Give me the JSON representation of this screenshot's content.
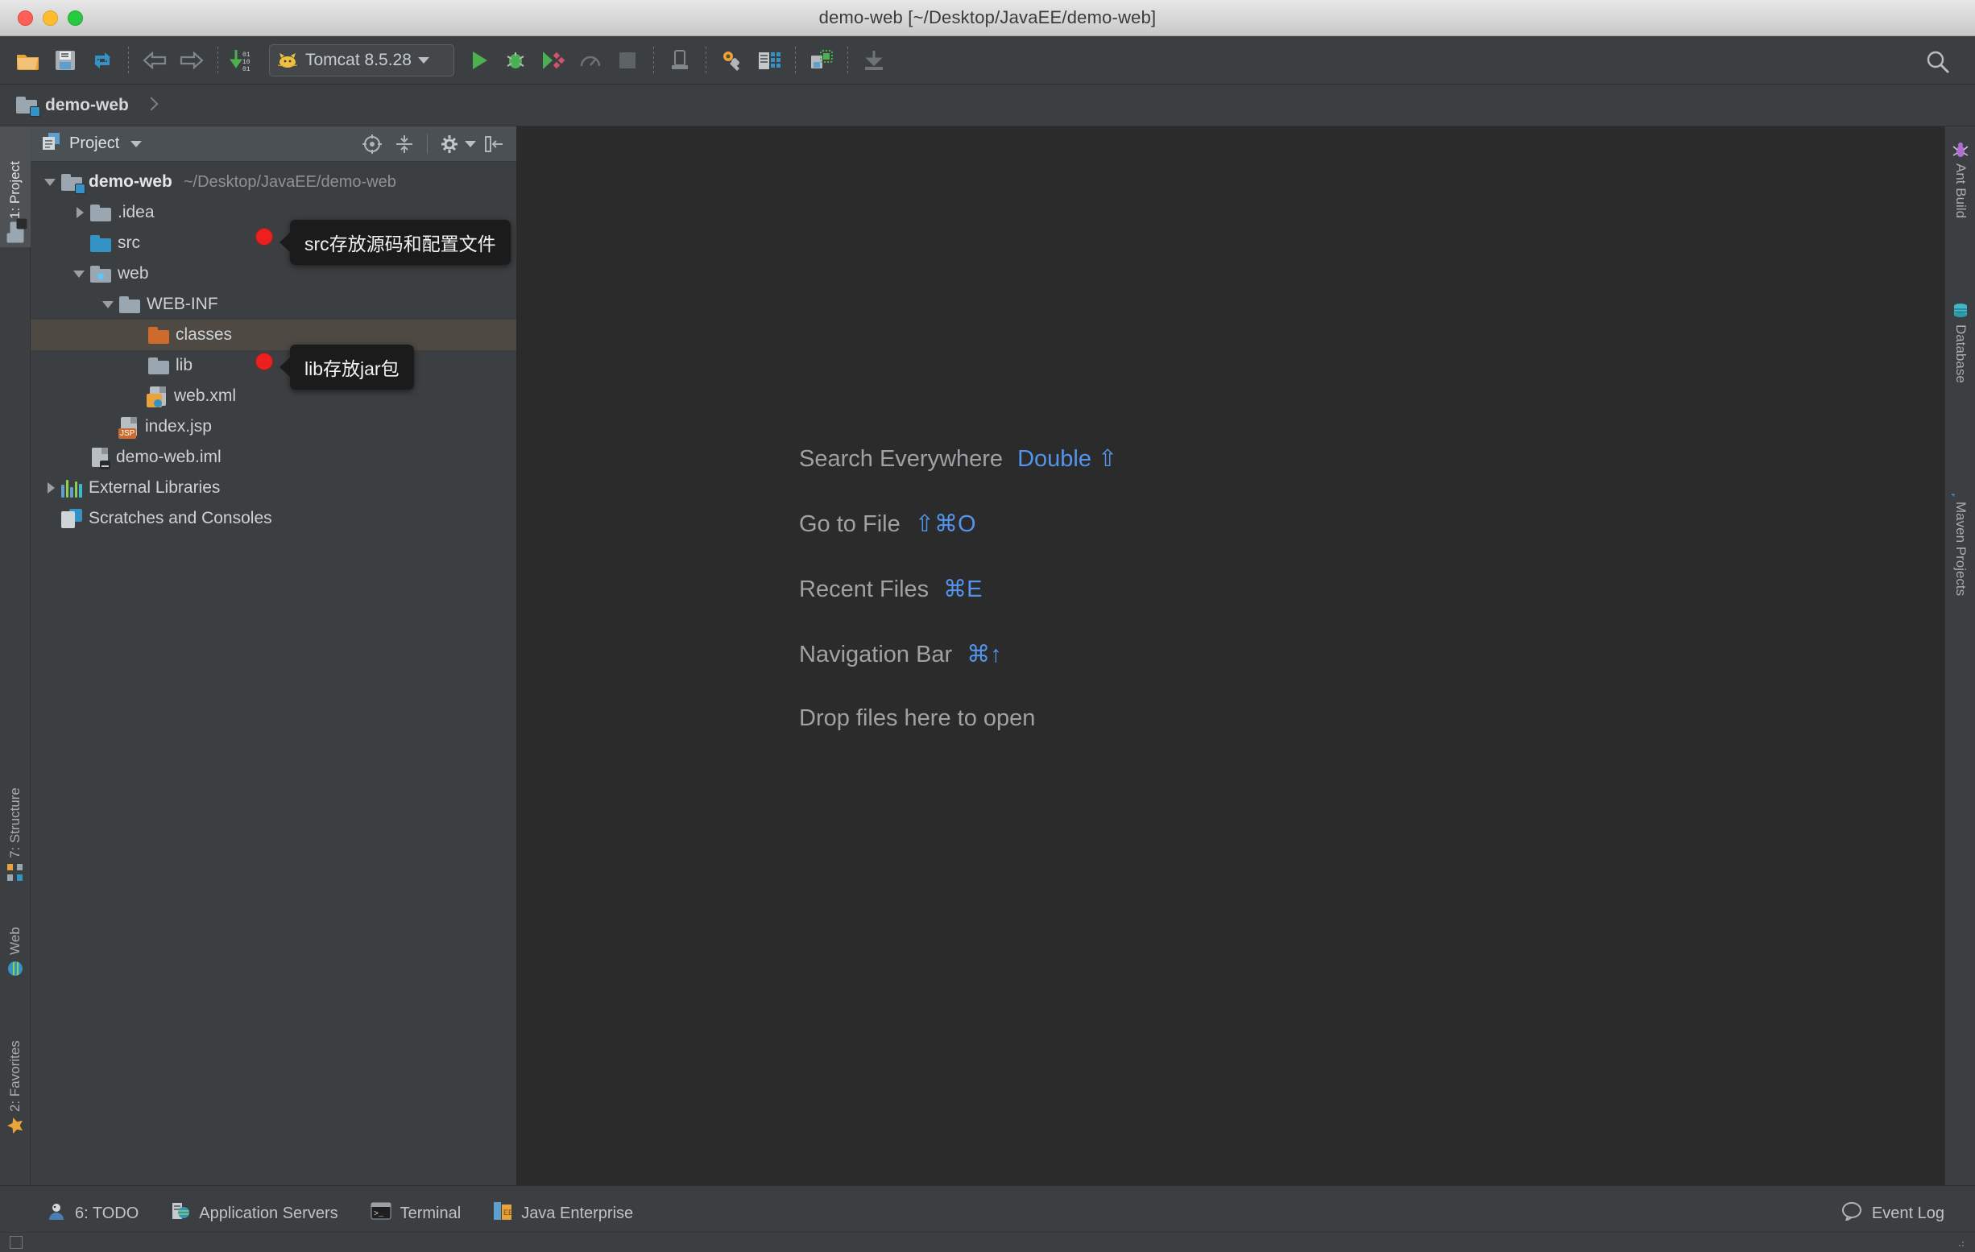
{
  "window": {
    "title": "demo-web [~/Desktop/JavaEE/demo-web]",
    "traffic_lights": [
      "close-red",
      "minimize-yellow",
      "zoom-green"
    ]
  },
  "toolbar": {
    "open_label": "Open",
    "save_label": "Save All",
    "sync_label": "Synchronize",
    "back_label": "Back",
    "forward_label": "Forward",
    "update_label": "Update Project",
    "run_config": {
      "name": "Tomcat 8.5.28",
      "icon": "tomcat-cat-icon"
    },
    "run_label": "Run",
    "debug_label": "Debug",
    "coverage_label": "Run with Coverage",
    "profile_label": "Profile",
    "stop_label": "Stop",
    "deploy_label": "Deploy",
    "settings_label": "Project Structure",
    "structure_label": "Settings",
    "sdk_label": "SDK",
    "download_label": "Download",
    "search_label": "Search"
  },
  "navbar": {
    "crumb": "demo-web"
  },
  "left_tool_strip": {
    "top": [
      {
        "label": "1: Project",
        "icon": "project-folder-icon",
        "selected": true
      }
    ],
    "bottom": [
      {
        "label": "7: Structure",
        "icon": "structure-icon",
        "selected": false
      },
      {
        "label": "Web",
        "icon": "web-globe-icon",
        "selected": false
      },
      {
        "label": "2: Favorites",
        "icon": "star-icon",
        "selected": false
      }
    ]
  },
  "right_tool_strip": [
    {
      "label": "Ant Build",
      "icon": "ant-icon"
    },
    {
      "label": "Database",
      "icon": "database-icon"
    },
    {
      "label": "Maven Projects",
      "icon": "maven-m-icon"
    }
  ],
  "project_panel": {
    "title": "Project",
    "view_icon": "project-view-icon",
    "dropdown_icon": "chevron-down-icon",
    "tools": [
      {
        "name": "scroll-from-source-icon",
        "label": "Select Opened File"
      },
      {
        "name": "collapse-all-icon",
        "label": "Collapse All"
      },
      {
        "name": "gear-icon",
        "label": "Settings"
      },
      {
        "name": "hide-panel-icon",
        "label": "Hide"
      }
    ],
    "tree": [
      {
        "id": "demo-web",
        "label": "demo-web",
        "path": "~/Desktop/JavaEE/demo-web",
        "indent": 0,
        "arrow": "open",
        "icon": "module-folder-icon",
        "bold": true,
        "selected": false
      },
      {
        "id": "idea",
        "label": ".idea",
        "path": "",
        "indent": 1,
        "arrow": "closed",
        "icon": "folder-grey-icon",
        "bold": false,
        "selected": false
      },
      {
        "id": "src",
        "label": "src",
        "path": "",
        "indent": 1,
        "arrow": "none",
        "icon": "folder-blue-icon",
        "bold": false,
        "selected": false
      },
      {
        "id": "web",
        "label": "web",
        "path": "",
        "indent": 1,
        "arrow": "open",
        "icon": "folder-web-icon",
        "bold": false,
        "selected": false
      },
      {
        "id": "web-inf",
        "label": "WEB-INF",
        "path": "",
        "indent": 2,
        "arrow": "open",
        "icon": "folder-grey-icon",
        "bold": false,
        "selected": false
      },
      {
        "id": "classes",
        "label": "classes",
        "path": "",
        "indent": 3,
        "arrow": "none",
        "icon": "folder-orange-icon",
        "bold": false,
        "selected": true
      },
      {
        "id": "lib",
        "label": "lib",
        "path": "",
        "indent": 3,
        "arrow": "none",
        "icon": "folder-grey-icon",
        "bold": false,
        "selected": false
      },
      {
        "id": "web-xml",
        "label": "web.xml",
        "path": "",
        "indent": 3,
        "arrow": "none",
        "icon": "xml-file-icon",
        "bold": false,
        "selected": false
      },
      {
        "id": "index-jsp",
        "label": "index.jsp",
        "path": "",
        "indent": 2,
        "arrow": "none",
        "icon": "jsp-file-icon",
        "bold": false,
        "selected": false
      },
      {
        "id": "demo-web-iml",
        "label": "demo-web.iml",
        "path": "",
        "indent": 1,
        "arrow": "none",
        "icon": "iml-file-icon",
        "bold": false,
        "selected": false
      },
      {
        "id": "external-libraries",
        "label": "External Libraries",
        "path": "",
        "indent": 0,
        "arrow": "closed",
        "icon": "libraries-icon",
        "bold": false,
        "selected": false
      },
      {
        "id": "scratches",
        "label": "Scratches and Consoles",
        "path": "",
        "indent": 0,
        "arrow": "none",
        "icon": "scratches-icon",
        "bold": false,
        "selected": false
      }
    ]
  },
  "annotations": [
    {
      "id": "anno-src",
      "text": "src存放源码和配置文件",
      "marker": "red-dot"
    },
    {
      "id": "anno-lib",
      "text": "lib存放jar包",
      "marker": "red-dot"
    }
  ],
  "editor": {
    "hints": [
      {
        "label": "Search Everywhere",
        "keys": "Double ⇧"
      },
      {
        "label": "Go to File",
        "keys": "⇧⌘O"
      },
      {
        "label": "Recent Files",
        "keys": "⌘E"
      },
      {
        "label": "Navigation Bar",
        "keys": "⌘↑"
      },
      {
        "label": "Drop files here to open",
        "keys": ""
      }
    ]
  },
  "statusbar": {
    "items": [
      {
        "label": "6: TODO",
        "underline": "6",
        "icon": "todo-icon"
      },
      {
        "label": "Application Servers",
        "underline": "",
        "icon": "app-servers-icon"
      },
      {
        "label": "Terminal",
        "underline": "",
        "icon": "terminal-icon"
      },
      {
        "label": "Java Enterprise",
        "underline": "",
        "icon": "java-ee-icon"
      }
    ],
    "event_log": {
      "label": "Event Log",
      "icon": "speech-bubble-icon"
    }
  },
  "colors": {
    "chrome": "#3c3f41",
    "editor_bg": "#2b2b2b",
    "panel_header": "#4a5054",
    "selection": "#4e4a43",
    "accent_blue": "#5394ec",
    "marker_red": "#f01f1f",
    "folder_blue": "#3592c4",
    "folder_orange": "#cc6b2c",
    "text_primary": "#cfd2d4",
    "text_dim": "#8d9295"
  }
}
